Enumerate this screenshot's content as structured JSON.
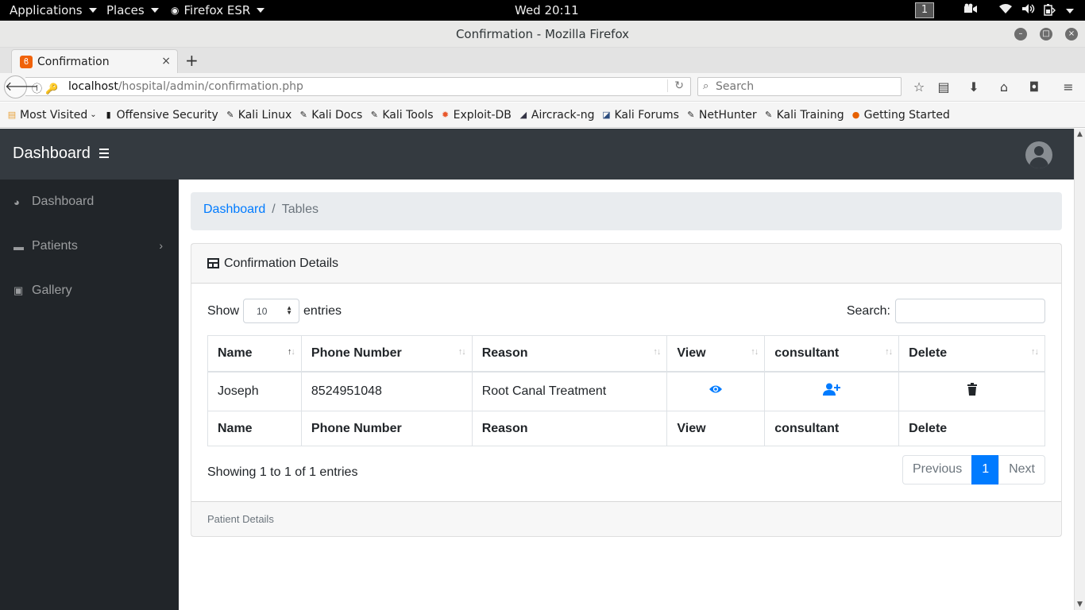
{
  "system": {
    "applications_label": "Applications",
    "places_label": "Places",
    "firefox_label": "Firefox ESR",
    "clock": "Wed 20:11",
    "workspace": "1"
  },
  "window": {
    "title": "Confirmation - Mozilla Firefox"
  },
  "tab": {
    "label": "Confirmation",
    "close": "×",
    "new": "+"
  },
  "navbar": {
    "url_host": "localhost",
    "url_path": "/hospital/admin/confirmation.php",
    "search_placeholder": "Search"
  },
  "bookmarks": [
    {
      "label": "Most Visited",
      "icon": "folder-icon",
      "color": "#e8a23a"
    },
    {
      "label": "Offensive Security",
      "icon": "offsec-icon",
      "color": "#1a1a1a"
    },
    {
      "label": "Kali Linux",
      "icon": "kali-icon",
      "color": "#222"
    },
    {
      "label": "Kali Docs",
      "icon": "kali-icon",
      "color": "#222"
    },
    {
      "label": "Kali Tools",
      "icon": "kali-icon",
      "color": "#222"
    },
    {
      "label": "Exploit-DB",
      "icon": "exploitdb-icon",
      "color": "#e8572a"
    },
    {
      "label": "Aircrack-ng",
      "icon": "aircrack-icon",
      "color": "#334"
    },
    {
      "label": "Kali Forums",
      "icon": "forums-icon",
      "color": "#2b4c7e"
    },
    {
      "label": "NetHunter",
      "icon": "kali-icon",
      "color": "#222"
    },
    {
      "label": "Kali Training",
      "icon": "kali-icon",
      "color": "#222"
    },
    {
      "label": "Getting Started",
      "icon": "firefox-icon",
      "color": "#e66000"
    }
  ],
  "app": {
    "brand": "Dashboard",
    "sidebar": [
      {
        "label": "Dashboard",
        "icon": "tachometer-icon"
      },
      {
        "label": "Patients",
        "icon": "folder-icon"
      },
      {
        "label": "Gallery",
        "icon": "image-icon"
      }
    ],
    "breadcrumb": {
      "link": "Dashboard",
      "separator": "/",
      "active": "Tables"
    },
    "card_title": "Confirmation Details",
    "show_label": "Show",
    "entries_label": "entries",
    "length_value": "10",
    "search_label": "Search:",
    "columns": [
      "Name",
      "Phone Number",
      "Reason",
      "View",
      "consultant",
      "Delete"
    ],
    "rows": [
      {
        "name": "Joseph",
        "phone": "8524951048",
        "reason": "Root Canal Treatment"
      }
    ],
    "info": "Showing 1 to 1 of 1 entries",
    "pager": {
      "previous": "Previous",
      "page": "1",
      "next": "Next"
    },
    "footer": "Patient Details",
    "colors": {
      "primary": "#007bff",
      "nav": "#343a40",
      "sidebar": "#212529"
    }
  }
}
